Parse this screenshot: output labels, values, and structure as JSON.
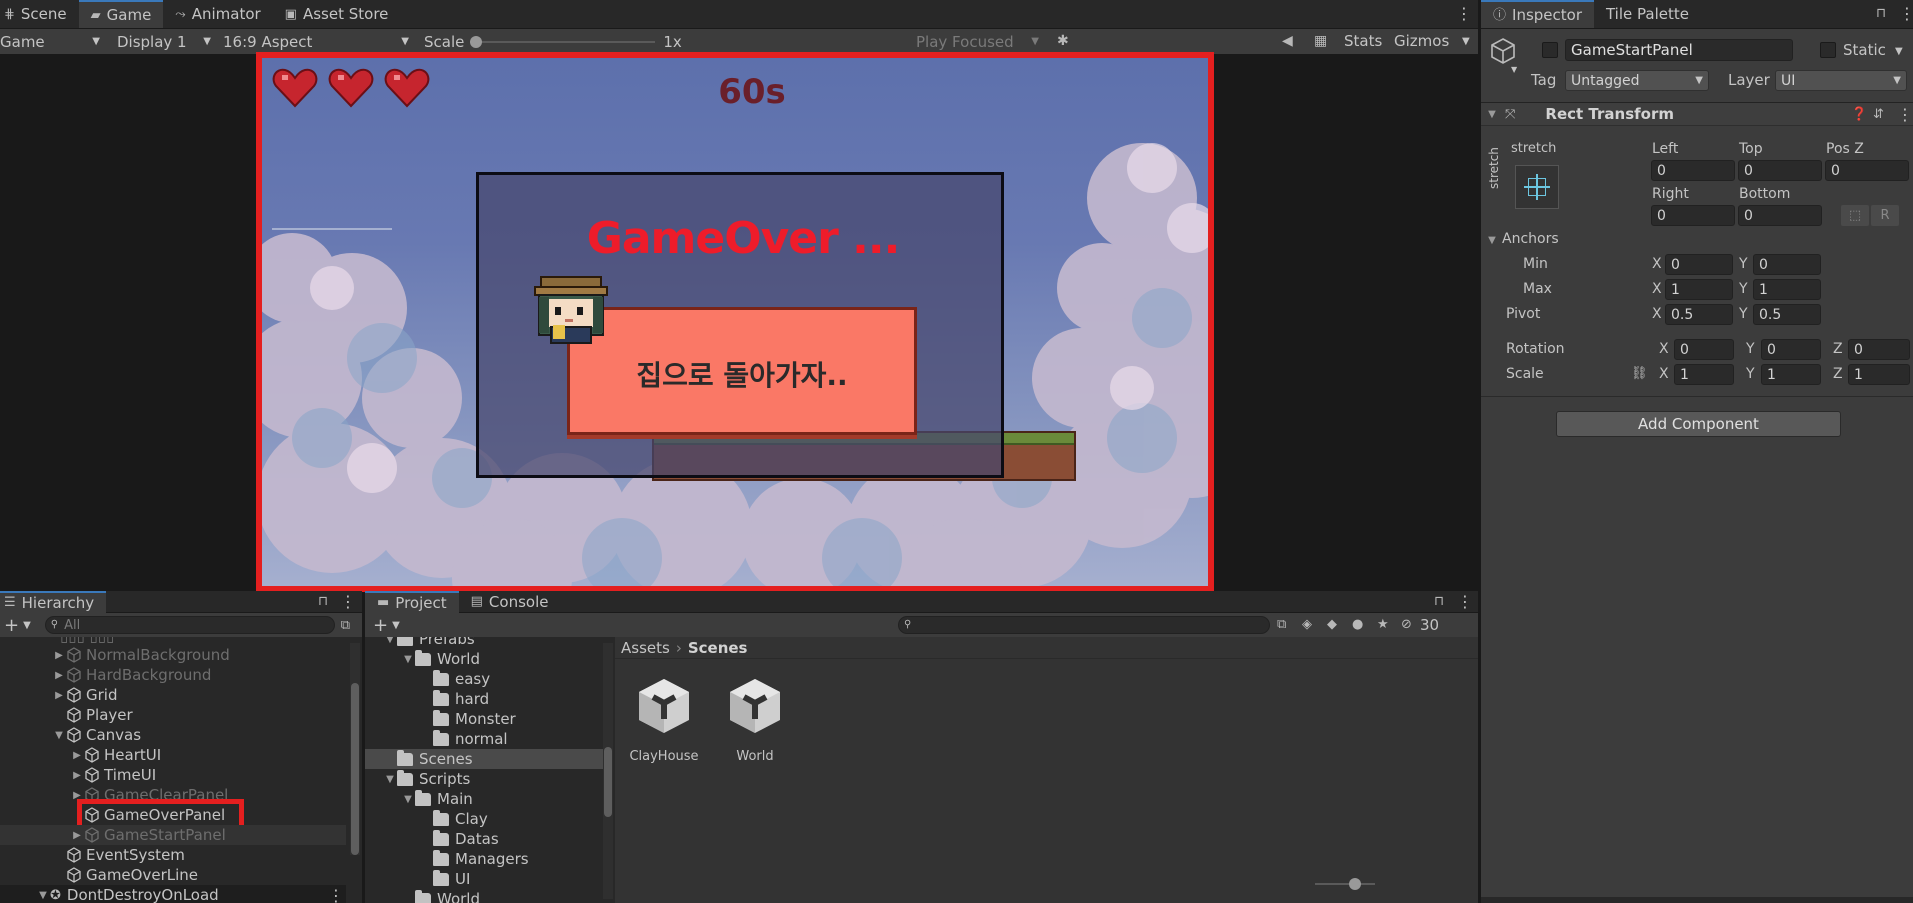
{
  "game_view": {
    "tabs": [
      {
        "label": "Scene",
        "icon": "grid-icon"
      },
      {
        "label": "Game",
        "icon": "gamepad-icon"
      },
      {
        "label": "Animator",
        "icon": "animator-icon"
      },
      {
        "label": "Asset Store",
        "icon": "bag-icon"
      }
    ],
    "toolbar": {
      "mode": "Game",
      "display": "Display 1",
      "aspect": "16:9 Aspect",
      "scale_label": "Scale",
      "scale_value": "1x",
      "play_mode": "Play Focused",
      "stats": "Stats",
      "gizmos": "Gizmos"
    },
    "game": {
      "hearts": 3,
      "timer": "60s",
      "gameover_title": "GameOver ...",
      "message": "집으로 돌아가자.."
    }
  },
  "inspector": {
    "tabs": [
      {
        "label": "Inspector",
        "icon": "info-icon"
      },
      {
        "label": "Tile Palette"
      }
    ],
    "object_name": "GameStartPanel",
    "static_label": "Static",
    "tag_label": "Tag",
    "tag_value": "Untagged",
    "layer_label": "Layer",
    "layer_value": "UI",
    "component": "Rect Transform",
    "anchor_preset_h": "stretch",
    "anchor_preset_v": "stretch",
    "left_label": "Left",
    "left": "0",
    "top_label": "Top",
    "top": "0",
    "posz_label": "Pos Z",
    "posz": "0",
    "right_label": "Right",
    "right": "0",
    "bottom_label": "Bottom",
    "bottom": "0",
    "anchors_label": "Anchors",
    "min_label": "Min",
    "min_x": "0",
    "min_y": "0",
    "max_label": "Max",
    "max_x": "1",
    "max_y": "1",
    "pivot_label": "Pivot",
    "pivot_x": "0.5",
    "pivot_y": "0.5",
    "rotation_label": "Rotation",
    "rot_x": "0",
    "rot_y": "0",
    "rot_z": "0",
    "scale_label": "Scale",
    "scale_x": "1",
    "scale_y": "1",
    "scale_z": "1",
    "add_component": "Add Component",
    "x": "X",
    "y": "Y",
    "z": "Z",
    "r": "R"
  },
  "hierarchy": {
    "title": "Hierarchy",
    "search_placeholder": "All",
    "items": [
      {
        "label": "NormalBackground",
        "depth": 1,
        "arrow": "right",
        "dim": true
      },
      {
        "label": "HardBackground",
        "depth": 1,
        "arrow": "right",
        "dim": true
      },
      {
        "label": "Grid",
        "depth": 1,
        "arrow": "right",
        "dim": false
      },
      {
        "label": "Player",
        "depth": 1,
        "arrow": "none",
        "dim": false
      },
      {
        "label": "Canvas",
        "depth": 1,
        "arrow": "down",
        "dim": false
      },
      {
        "label": "HeartUI",
        "depth": 2,
        "arrow": "right",
        "dim": false
      },
      {
        "label": "TimeUI",
        "depth": 2,
        "arrow": "right",
        "dim": false
      },
      {
        "label": "GameClearPanel",
        "depth": 2,
        "arrow": "right",
        "dim": true
      },
      {
        "label": "GameOverPanel",
        "depth": 2,
        "arrow": "none",
        "dim": false,
        "highlight": true
      },
      {
        "label": "GameStartPanel",
        "depth": 2,
        "arrow": "right",
        "dim": true,
        "selected": true
      },
      {
        "label": "EventSystem",
        "depth": 1,
        "arrow": "none",
        "dim": false
      },
      {
        "label": "GameOverLine",
        "depth": 1,
        "arrow": "none",
        "dim": false
      }
    ],
    "ddol": "DontDestroyOnLoad"
  },
  "project": {
    "tabs": [
      {
        "label": "Project",
        "icon": "folder-icon"
      },
      {
        "label": "Console",
        "icon": "console-icon"
      }
    ],
    "hidden_count": "30",
    "tree": [
      {
        "label": "Prefabs",
        "depth": 1,
        "arrow": "down"
      },
      {
        "label": "World",
        "depth": 2,
        "arrow": "down"
      },
      {
        "label": "easy",
        "depth": 3,
        "arrow": "none"
      },
      {
        "label": "hard",
        "depth": 3,
        "arrow": "none"
      },
      {
        "label": "Monster",
        "depth": 3,
        "arrow": "none"
      },
      {
        "label": "normal",
        "depth": 3,
        "arrow": "none"
      },
      {
        "label": "Scenes",
        "depth": 1,
        "arrow": "none",
        "selected": true
      },
      {
        "label": "Scripts",
        "depth": 1,
        "arrow": "down"
      },
      {
        "label": "Main",
        "depth": 2,
        "arrow": "down"
      },
      {
        "label": "Clay",
        "depth": 3,
        "arrow": "none"
      },
      {
        "label": "Datas",
        "depth": 3,
        "arrow": "none"
      },
      {
        "label": "Managers",
        "depth": 3,
        "arrow": "none"
      },
      {
        "label": "UI",
        "depth": 3,
        "arrow": "none"
      },
      {
        "label": "World",
        "depth": 2,
        "arrow": "none"
      }
    ],
    "breadcrumb": [
      "Assets",
      "Scenes"
    ],
    "assets": [
      {
        "label": "ClayHouse"
      },
      {
        "label": "World"
      }
    ]
  }
}
